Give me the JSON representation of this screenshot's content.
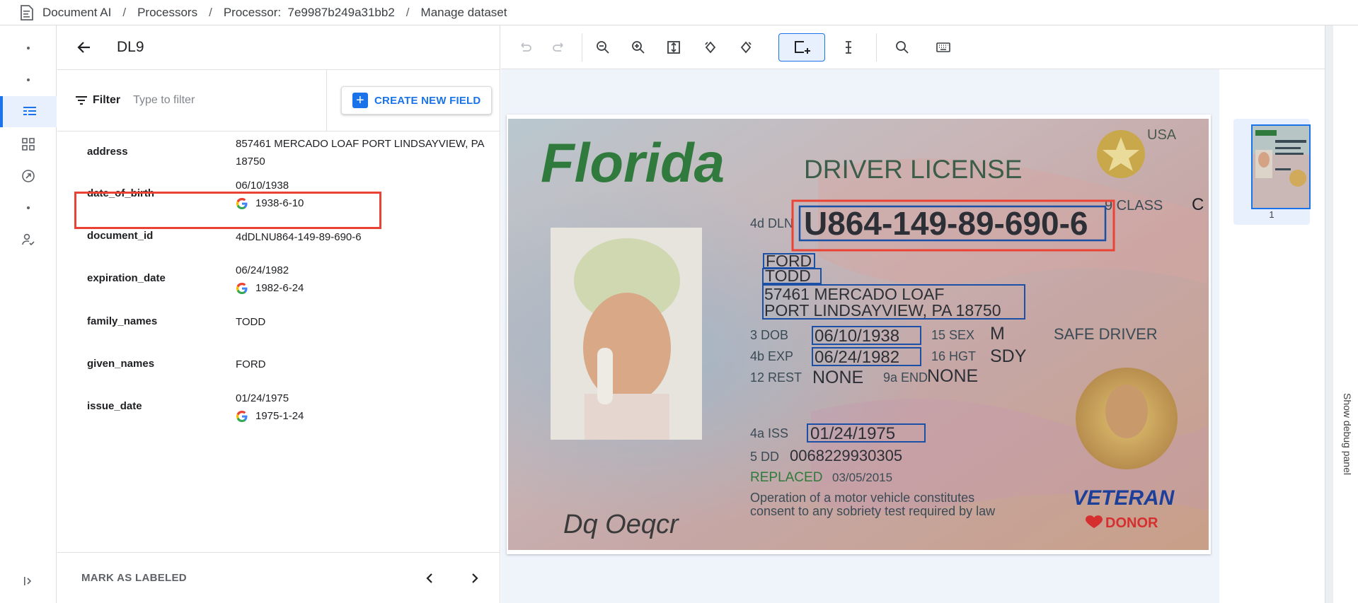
{
  "breadcrumb": {
    "items": [
      "Document AI",
      "Processors",
      "Processor:  7e9987b249a31bb2",
      "Manage dataset"
    ],
    "separator": "/"
  },
  "panel": {
    "title": "DL9",
    "filter_label": "Filter",
    "filter_placeholder": "Type to filter",
    "create_button": "CREATE NEW FIELD",
    "mark_button": "MARK AS LABELED"
  },
  "fields": [
    {
      "name": "address",
      "value": "857461 MERCADO LOAF PORT LINDSAYVIEW, PA 18750",
      "normalized": ""
    },
    {
      "name": "date_of_birth",
      "value": "06/10/1938",
      "normalized": "1938-6-10"
    },
    {
      "name": "document_id",
      "value": "4dDLNU864-149-89-690-6",
      "normalized": ""
    },
    {
      "name": "expiration_date",
      "value": "06/24/1982",
      "normalized": "1982-6-24"
    },
    {
      "name": "family_names",
      "value": "TODD",
      "normalized": ""
    },
    {
      "name": "given_names",
      "value": "FORD",
      "normalized": ""
    },
    {
      "name": "issue_date",
      "value": "01/24/1975",
      "normalized": "1975-1-24"
    }
  ],
  "license": {
    "state": "Florida",
    "heading": "DRIVER LICENSE",
    "country": "USA",
    "class_label": "9 CLASS",
    "class_value": "C",
    "dl_label": "4d DLN",
    "dl_number": "U864-149-89-690-6",
    "given": "FORD",
    "family": "TODD",
    "address_1": "57461 MERCADO LOAF",
    "address_2": "PORT LINDSAYVIEW, PA 18750",
    "dob_label": "3  DOB",
    "dob": "06/10/1938",
    "sex_label": "15 SEX",
    "sex": "M",
    "exp_label": "4b EXP",
    "exp": "06/24/1982",
    "hgt_label": "16 HGT",
    "hgt": "SDY",
    "rest_label": "12 REST",
    "rest": "NONE",
    "end_label": "9a END",
    "end": "NONE",
    "safe": "SAFE DRIVER",
    "iss_label": "4a ISS",
    "iss": "01/24/1975",
    "dd_label": "5 DD",
    "dd": "0068229930305",
    "replaced_label": "REPLACED",
    "replaced": "03/05/2015",
    "fine_1": "Operation of a motor vehicle constitutes",
    "fine_2": "consent to any sobriety test required by law",
    "signature": "Dq Oeqcr",
    "veteran": "VETERAN",
    "donor": "DONOR"
  },
  "thumbnail": {
    "page": "1"
  },
  "debug_label": "Show debug panel",
  "colors": {
    "accent": "#1a73e8",
    "highlight": "#ea4335",
    "bbox": "#1c4fa6"
  }
}
